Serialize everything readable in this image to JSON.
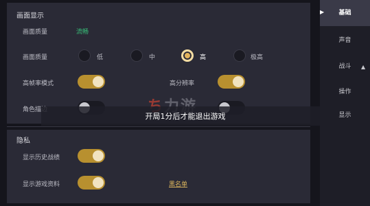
{
  "display": {
    "section_title": "画面显示",
    "quality_label": "画面质量",
    "quality_value": "流畅",
    "quality2_label": "画面质量",
    "options": [
      "低",
      "中",
      "高",
      "极高"
    ],
    "selected_option": "高",
    "high_fps_label": "高帧率模式",
    "high_res_label": "高分辨率",
    "outline_label": "角色描边"
  },
  "toast": "开局1分后才能退出游戏",
  "watermark": "力游",
  "privacy": {
    "section_title": "隐私",
    "history_label": "显示历史战绩",
    "profile_label": "显示游戏资料",
    "blacklist_link": "黑名单"
  },
  "sidebar": {
    "items": [
      "基础",
      "声音",
      "战斗",
      "操作",
      "显示"
    ]
  },
  "colors": {
    "accent": "#e3b45c",
    "toggle_on": "#b8902f",
    "green": "#38c27a"
  }
}
